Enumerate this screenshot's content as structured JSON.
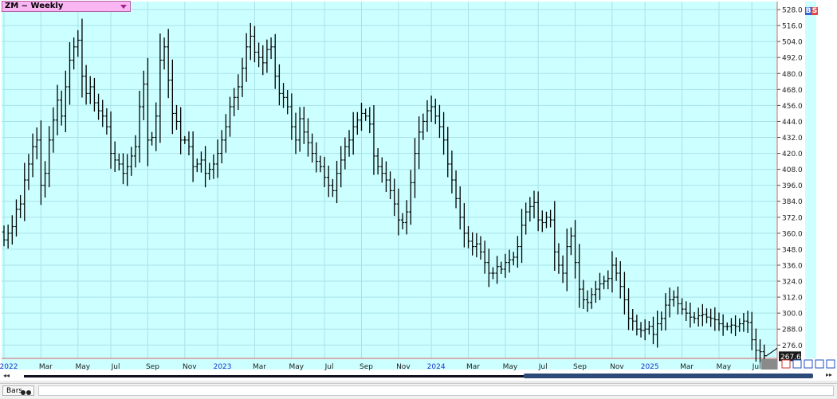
{
  "header": {
    "symbol_label": "ZM ~ Weekly"
  },
  "corner_badges": {
    "b": "B",
    "s": "S"
  },
  "colors": {
    "plot_bg": "#ccffff",
    "grid": "#a9e2e8",
    "bar": "#000000",
    "axis_line": "#e06060",
    "last_bg": "#1a1a1a"
  },
  "footer": {
    "tab_label": "Bars"
  },
  "chart_data": {
    "type": "ohlc",
    "grid": true,
    "ylim": [
      266,
      534
    ],
    "y_ticks": [
      "528.0",
      "516.0",
      "504.0",
      "492.0",
      "480.0",
      "468.0",
      "456.0",
      "444.0",
      "432.0",
      "420.0",
      "408.0",
      "396.0",
      "384.0",
      "372.0",
      "360.0",
      "348.0",
      "336.0",
      "324.0",
      "312.0",
      "300.0",
      "288.0",
      "276.0"
    ],
    "x_ticks": [
      {
        "label": "2022",
        "week": 0,
        "year": true
      },
      {
        "label": "Mar",
        "week": 9
      },
      {
        "label": "May",
        "week": 18
      },
      {
        "label": "Jul",
        "week": 26
      },
      {
        "label": "Sep",
        "week": 35
      },
      {
        "label": "Nov",
        "week": 44
      },
      {
        "label": "2023",
        "week": 52,
        "year": true
      },
      {
        "label": "Mar",
        "week": 61
      },
      {
        "label": "May",
        "week": 70
      },
      {
        "label": "Jul",
        "week": 78
      },
      {
        "label": "Sep",
        "week": 87
      },
      {
        "label": "Nov",
        "week": 96
      },
      {
        "label": "2024",
        "week": 104,
        "year": true
      },
      {
        "label": "Mar",
        "week": 113
      },
      {
        "label": "May",
        "week": 122
      },
      {
        "label": "Jul",
        "week": 130
      },
      {
        "label": "Sep",
        "week": 139
      },
      {
        "label": "Nov",
        "week": 148
      },
      {
        "label": "2025",
        "week": 156,
        "year": true
      },
      {
        "label": "Mar",
        "week": 165
      },
      {
        "label": "May",
        "week": 174
      },
      {
        "label": "Jul",
        "week": 182
      }
    ],
    "close_path": [
      355,
      360,
      365,
      378,
      382,
      400,
      412,
      425,
      430,
      396,
      405,
      430,
      445,
      460,
      448,
      470,
      490,
      500,
      505,
      478,
      465,
      470,
      458,
      452,
      448,
      440,
      420,
      415,
      412,
      405,
      410,
      418,
      425,
      455,
      472,
      430,
      432,
      448,
      490,
      500,
      475,
      450,
      444,
      430,
      430,
      425,
      410,
      412,
      415,
      405,
      408,
      412,
      420,
      430,
      440,
      455,
      462,
      470,
      484,
      500,
      508,
      496,
      492,
      488,
      498,
      500,
      478,
      465,
      462,
      455,
      440,
      430,
      446,
      436,
      428,
      420,
      414,
      410,
      402,
      396,
      392,
      405,
      415,
      425,
      430,
      440,
      445,
      450,
      448,
      442,
      418,
      410,
      405,
      400,
      392,
      382,
      370,
      368,
      376,
      398,
      420,
      436,
      444,
      452,
      455,
      448,
      440,
      430,
      412,
      400,
      386,
      372,
      360,
      354,
      350,
      352,
      346,
      338,
      330,
      330,
      335,
      333,
      338,
      340,
      342,
      350,
      366,
      376,
      380,
      383,
      370,
      368,
      372,
      370,
      346,
      336,
      330,
      350,
      358,
      338,
      318,
      310,
      308,
      314,
      318,
      322,
      324,
      326,
      336,
      330,
      320,
      310,
      296,
      294,
      288,
      287,
      288,
      290,
      284,
      292,
      296,
      306,
      310,
      312,
      307,
      303,
      300,
      297,
      296,
      298,
      299,
      297,
      296,
      295,
      292,
      290,
      290,
      291,
      290,
      292,
      294,
      293,
      280,
      272,
      271,
      268
    ],
    "last_price": "267.6"
  }
}
